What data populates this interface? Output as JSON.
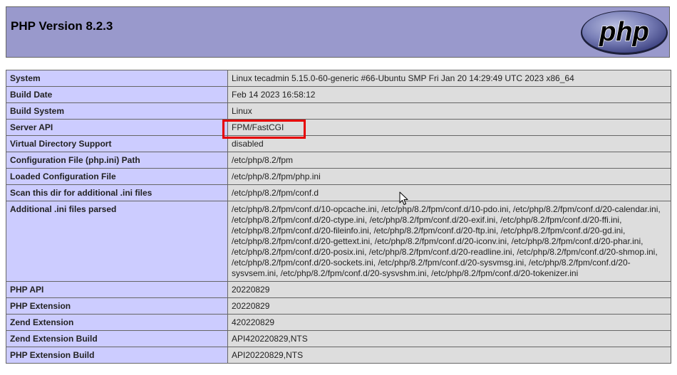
{
  "header": {
    "title": "PHP Version 8.2.3",
    "logo_text": "php",
    "colors": {
      "header_bg": "#9999cc",
      "label_bg": "#ccccff",
      "value_bg": "#dddddd",
      "highlight": "#e60000"
    }
  },
  "rows": [
    {
      "label": "System",
      "value": "Linux tecadmin 5.15.0-60-generic #66-Ubuntu SMP Fri Jan 20 14:29:49 UTC 2023 x86_64"
    },
    {
      "label": "Build Date",
      "value": "Feb 14 2023 16:58:12"
    },
    {
      "label": "Build System",
      "value": "Linux"
    },
    {
      "label": "Server API",
      "value": "FPM/FastCGI"
    },
    {
      "label": "Virtual Directory Support",
      "value": "disabled"
    },
    {
      "label": "Configuration File (php.ini) Path",
      "value": "/etc/php/8.2/fpm"
    },
    {
      "label": "Loaded Configuration File",
      "value": "/etc/php/8.2/fpm/php.ini"
    },
    {
      "label": "Scan this dir for additional .ini files",
      "value": "/etc/php/8.2/fpm/conf.d"
    },
    {
      "label": "Additional .ini files parsed",
      "value": "/etc/php/8.2/fpm/conf.d/10-opcache.ini, /etc/php/8.2/fpm/conf.d/10-pdo.ini, /etc/php/8.2/fpm/conf.d/20-calendar.ini, /etc/php/8.2/fpm/conf.d/20-ctype.ini, /etc/php/8.2/fpm/conf.d/20-exif.ini, /etc/php/8.2/fpm/conf.d/20-ffi.ini, /etc/php/8.2/fpm/conf.d/20-fileinfo.ini, /etc/php/8.2/fpm/conf.d/20-ftp.ini, /etc/php/8.2/fpm/conf.d/20-gd.ini, /etc/php/8.2/fpm/conf.d/20-gettext.ini, /etc/php/8.2/fpm/conf.d/20-iconv.ini, /etc/php/8.2/fpm/conf.d/20-phar.ini, /etc/php/8.2/fpm/conf.d/20-posix.ini, /etc/php/8.2/fpm/conf.d/20-readline.ini, /etc/php/8.2/fpm/conf.d/20-shmop.ini, /etc/php/8.2/fpm/conf.d/20-sockets.ini, /etc/php/8.2/fpm/conf.d/20-sysvmsg.ini, /etc/php/8.2/fpm/conf.d/20-sysvsem.ini, /etc/php/8.2/fpm/conf.d/20-sysvshm.ini, /etc/php/8.2/fpm/conf.d/20-tokenizer.ini"
    },
    {
      "label": "PHP API",
      "value": "20220829"
    },
    {
      "label": "PHP Extension",
      "value": "20220829"
    },
    {
      "label": "Zend Extension",
      "value": "420220829"
    },
    {
      "label": "Zend Extension Build",
      "value": "API420220829,NTS"
    },
    {
      "label": "PHP Extension Build",
      "value": "API20220829,NTS"
    }
  ]
}
